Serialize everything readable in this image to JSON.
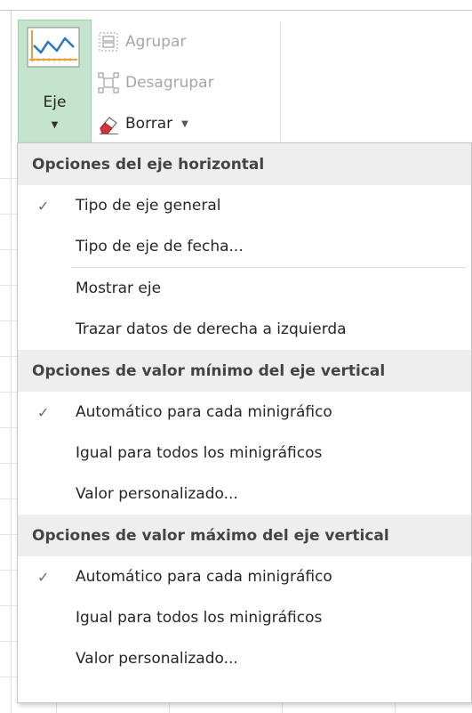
{
  "ribbon": {
    "axis_button": {
      "label": "Eje",
      "icon": "axis-chart-icon"
    },
    "group": {
      "label": "Agrupar",
      "icon": "group-icon"
    },
    "ungroup": {
      "label": "Desagrupar",
      "icon": "ungroup-icon"
    },
    "clear": {
      "label": "Borrar",
      "icon": "eraser-icon"
    }
  },
  "menu": {
    "sections": [
      {
        "header": "Opciones del eje horizontal",
        "items": [
          {
            "label": "Tipo de eje general",
            "checked": true
          },
          {
            "label": "Tipo de eje de fecha...",
            "checked": false
          },
          {
            "label": "Mostrar eje",
            "checked": false
          },
          {
            "label": "Trazar datos de derecha a izquierda",
            "checked": false
          }
        ]
      },
      {
        "header": "Opciones de valor mínimo del eje vertical",
        "items": [
          {
            "label": "Automático para cada minigráfico",
            "checked": true
          },
          {
            "label": "Igual para todos los minigráficos",
            "checked": false
          },
          {
            "label": "Valor personalizado...",
            "checked": false
          }
        ]
      },
      {
        "header": "Opciones de valor máximo del eje vertical",
        "items": [
          {
            "label": "Automático para cada minigráfico",
            "checked": true
          },
          {
            "label": "Igual para todos los minigráficos",
            "checked": false
          },
          {
            "label": "Valor personalizado...",
            "checked": false
          }
        ]
      }
    ],
    "check_glyph": "✓"
  },
  "colors": {
    "axis_button_bg": "#c5e4ce",
    "header_bg": "#eeeeee",
    "disabled_text": "#a6a6a6",
    "eraser_red": "#d13438"
  }
}
